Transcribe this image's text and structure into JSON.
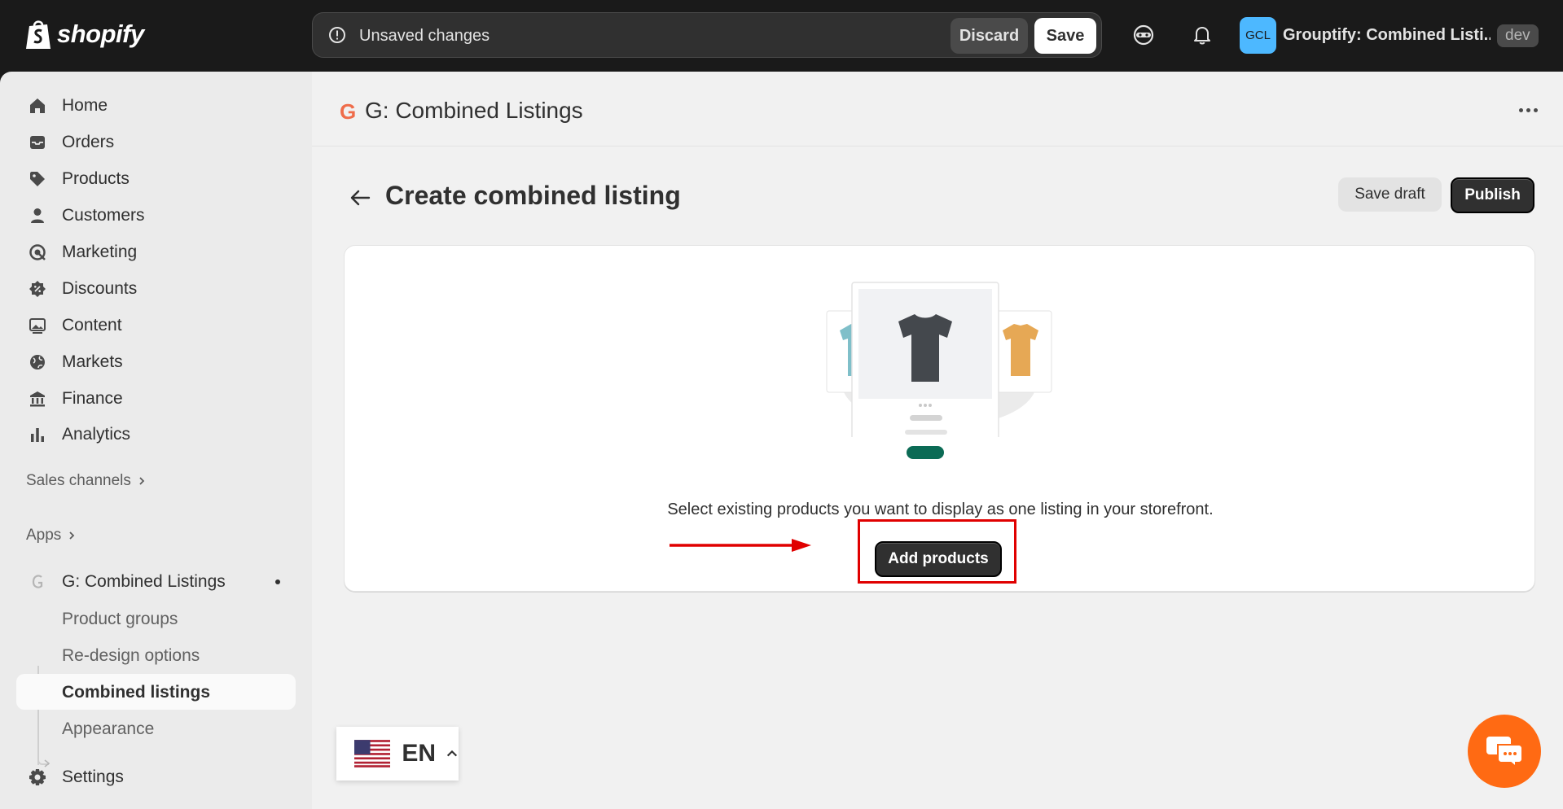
{
  "topbar": {
    "logo_text": "shopify",
    "unsaved_message": "Unsaved changes",
    "discard_label": "Discard",
    "save_label": "Save",
    "store_initials": "GCL",
    "store_name": "Grouptify: Combined Listi...",
    "store_tag": "dev"
  },
  "sidebar": {
    "items": [
      {
        "label": "Home",
        "icon": "home-icon"
      },
      {
        "label": "Orders",
        "icon": "inbox-icon"
      },
      {
        "label": "Products",
        "icon": "tag-icon"
      },
      {
        "label": "Customers",
        "icon": "person-icon"
      },
      {
        "label": "Marketing",
        "icon": "target-icon"
      },
      {
        "label": "Discounts",
        "icon": "discount-icon"
      },
      {
        "label": "Content",
        "icon": "image-icon"
      },
      {
        "label": "Markets",
        "icon": "globe-icon"
      },
      {
        "label": "Finance",
        "icon": "bank-icon"
      },
      {
        "label": "Analytics",
        "icon": "bar-chart-icon"
      }
    ],
    "sales_channels_label": "Sales channels",
    "apps_label": "Apps",
    "app_name": "G: Combined Listings",
    "app_subitems": [
      "Product groups",
      "Re-design options",
      "Combined listings",
      "Appearance"
    ],
    "active_subitem": "Combined listings",
    "settings_label": "Settings"
  },
  "app_header": {
    "icon_letter": "G",
    "title": "G: Combined Listings"
  },
  "page": {
    "title": "Create combined listing",
    "save_draft_label": "Save draft",
    "publish_label": "Publish",
    "empty_state_text": "Select existing products you want to display as one listing in your storefront.",
    "add_products_label": "Add products"
  },
  "language": {
    "code": "EN"
  },
  "colors": {
    "accent_highlight": "#e00000",
    "chat_button": "#ff6a13",
    "store_avatar": "#4db8ff",
    "app_icon": "#ef6c4a"
  }
}
